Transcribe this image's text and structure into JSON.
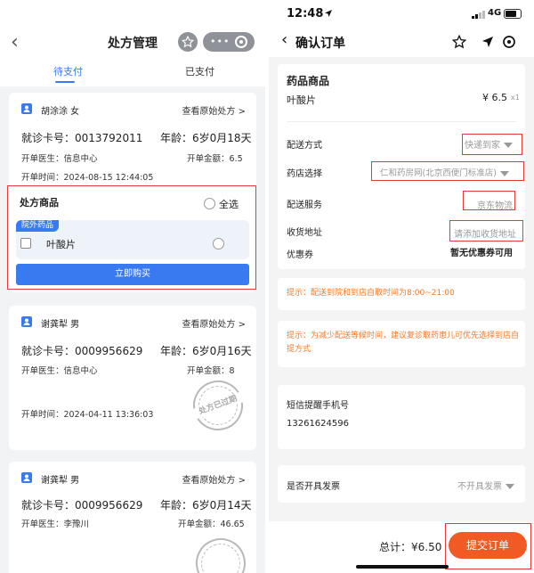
{
  "left": {
    "title": "处方管理",
    "back_icon": "chevron-left-icon",
    "capsule_dots": "•••",
    "tabs": [
      "待支付",
      "已支付"
    ],
    "cards": [
      {
        "name": "胡涂涂 女",
        "view_link": "查看原始处方 >",
        "card_no": "就诊卡号：0013792011",
        "age": "年龄：6岁0月18天",
        "doctor": "开单医生：信息中心",
        "amount": "开单金额：6.5",
        "time": "开单时间：2024-08-15 12:44:05",
        "section_title": "处方商品",
        "select_all": "全选",
        "tag": "院外药品",
        "drug": "叶酸片",
        "buy_button": "立即购买"
      },
      {
        "name": "谢龚犁 男",
        "view_link": "查看原始处方 >",
        "card_no": "就诊卡号：0009956629",
        "age": "年龄：6岁0月16天",
        "doctor": "开单医生：信息中心",
        "amount": "开单金额：8",
        "time": "开单时间：2024-04-11 13:36:03",
        "stamp": "处方已过期"
      },
      {
        "name": "谢龚犁 男",
        "view_link": "查看原始处方 >",
        "card_no": "就诊卡号：0009956629",
        "age": "年龄：6岁0月14天",
        "doctor": "开单医生：李豫川",
        "amount": "开单金额：46.65"
      }
    ]
  },
  "right": {
    "status_time": "12:48",
    "network": "4G",
    "title": "确认订单",
    "goods_header": "药品商品",
    "drug_name": "叶酸片",
    "drug_price": "¥ 6.5",
    "drug_qty": "x1",
    "delivery_label": "配送方式",
    "delivery_value": "快递到家",
    "pharmacy_label": "药店选择",
    "pharmacy_value": "仁和药房网(北京西便门标准店)",
    "service_label": "配送服务",
    "service_value": "京东物流",
    "address_label": "收货地址",
    "address_placeholder": "请添加收货地址",
    "coupon_label": "优惠券",
    "coupon_value": "暂无优惠券可用",
    "tip1": "提示：配送到院和到店自取时间为8:00~21:00",
    "tip2": "提示：为减少配送等候时间，建议复诊取药患儿可优先选择到店自提方式",
    "sms_label": "短信提醒手机号",
    "sms_phone": "13261624596",
    "invoice_label": "是否开具发票",
    "invoice_value": "不开具发票",
    "total": "总计：¥6.50",
    "submit_button": "提交订单"
  },
  "colors": {
    "accent_blue": "#3a7af0",
    "highlight_red": "#e83a3a",
    "submit_orange": "#f25a23",
    "tip_orange": "#f07a2a"
  }
}
